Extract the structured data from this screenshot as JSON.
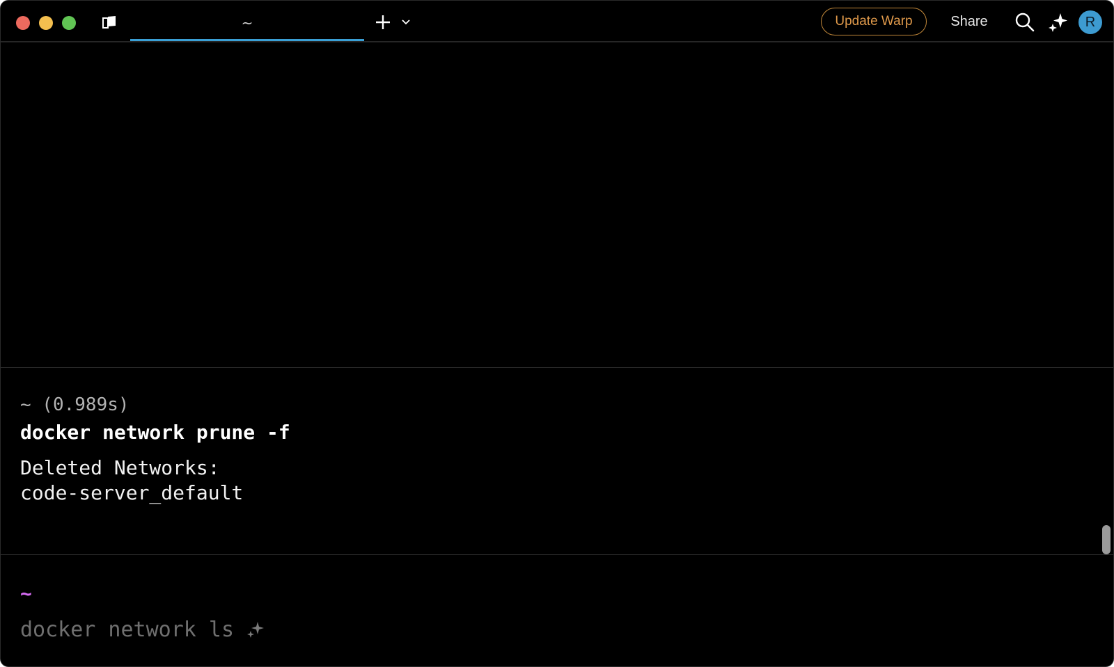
{
  "titlebar": {
    "tab_title": "~",
    "update_label": "Update Warp",
    "share_label": "Share",
    "avatar_initial": "R"
  },
  "blocks": [
    {
      "header": "~ (0.989s)",
      "command": "docker network prune -f",
      "output": "Deleted Networks:\ncode-server_default"
    }
  ],
  "prompt": {
    "directory": "~",
    "suggestion": "docker network ls"
  },
  "colors": {
    "tab_underline": "#3a9fd5",
    "update_accent": "#e09a4b",
    "prompt_dir": "#d56bf2",
    "avatar": "#3d9bd1"
  },
  "icons": {
    "panel": "panel-icon",
    "new_tab": "plus-icon",
    "dropdown": "chevron-down-icon",
    "search": "search-icon",
    "ai": "sparkle-icon"
  }
}
